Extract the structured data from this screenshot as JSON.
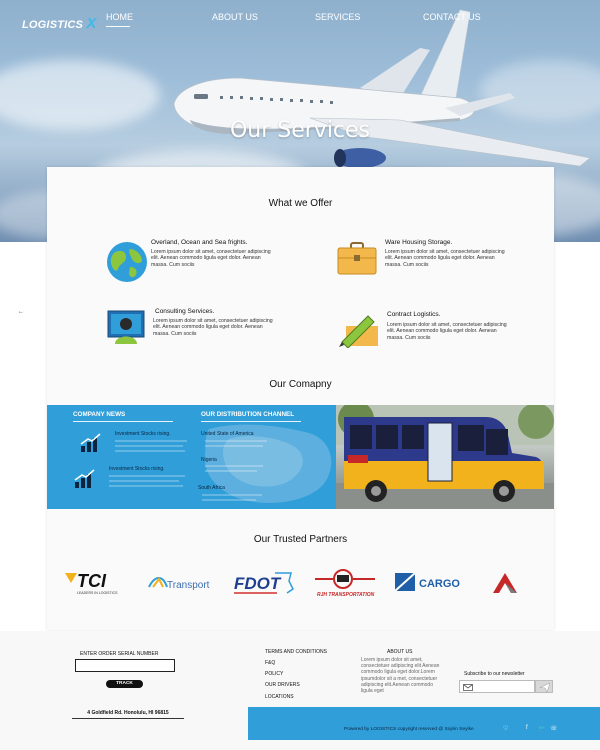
{
  "brand": {
    "logo_text": "LOGISTICS",
    "logo_x": "X"
  },
  "nav": {
    "items": [
      {
        "label": "HOME"
      },
      {
        "label": "ABOUT US"
      },
      {
        "label": "SERVICES"
      },
      {
        "label": "CONTACT US"
      }
    ]
  },
  "hero": {
    "title": "Our Services"
  },
  "offer": {
    "title": "What we Offer",
    "items": [
      {
        "title": "Overland, Ocean and Sea frights.",
        "text": "Lorem ipsum dolor sit amet, consectetuer adipiscing elit. Aenean commodo ligula eget dolor. Aenean massa. Cum sociis",
        "icon": "globe-icon"
      },
      {
        "title": "Ware Housing Storage.",
        "text": "Lorem ipsum dolor sit amet, consectetuer adipiscing elit. Aenean commodo ligula eget dolor. Aenean massa. Cum sociis",
        "icon": "briefcase-icon"
      },
      {
        "title": "Consulting Services.",
        "text": "Lorem ipsum dolor sit amet, consectetuer adipiscing elit. Aenean commodo ligula eget dolor. Aenean massa. Cum sociis",
        "icon": "monitor-user-icon"
      },
      {
        "title": "Contract Logistics.",
        "text": "Lorem ipsum dolor sit amet, consectetuer adipiscing elit. Aenean commodo ligula eget dolor. Aenean massa. Cum sociis",
        "icon": "pen-contract-icon"
      }
    ]
  },
  "company": {
    "title": "Our Comapny",
    "news_heading": "COMPANY NEWS",
    "news": [
      {
        "title": "Investment Stocks rising."
      },
      {
        "title": "Investment Stocks rising."
      }
    ],
    "distribution_heading": "OUR DISTRIBUTION CHANNEL",
    "regions": [
      "United State of America",
      "Nigeria",
      "South Africa"
    ]
  },
  "partners": {
    "title": "Our Trusted  Partners",
    "logos": [
      {
        "name": "TCI",
        "tagline": "LEADERS IN LOGISTICS"
      },
      {
        "name": "Transport"
      },
      {
        "name": "FDOT"
      },
      {
        "name": "RJH TRANSPORTATION"
      },
      {
        "name": "CARGO"
      },
      {
        "name": "A"
      }
    ]
  },
  "footer": {
    "serial_label": "ENTER  ORDER  SERIAL NUMBER",
    "track_label": "TRACK",
    "address": "4 Goldfield Rd.  Honolulu, HI 96815",
    "links": [
      "TERMS AND CONDITIONS",
      "F&Q",
      "POLICY",
      "OUR DRIVERS",
      "LOCATIONS"
    ],
    "about_heading": "ABOUT US",
    "about_text": "Lorem ipsum dolor sit amet, consectetuer adipiscing elit Aenean commodo ligula eget dolor.Lorem ipsumdolor sit a met, consectetuer adipiscing elit.Aenean commodo ligula eget",
    "newsletter_label": "Subscribe to our newsletter",
    "powered": "Powered by LOGISTICS  copyright reserved @ Sojirin Seyike",
    "social_icons": [
      "heart-icon",
      "facebook-icon",
      "twitter-icon",
      "phone-icon"
    ]
  },
  "colors": {
    "accent": "#2f9ed9",
    "dark": "#0b2540"
  }
}
